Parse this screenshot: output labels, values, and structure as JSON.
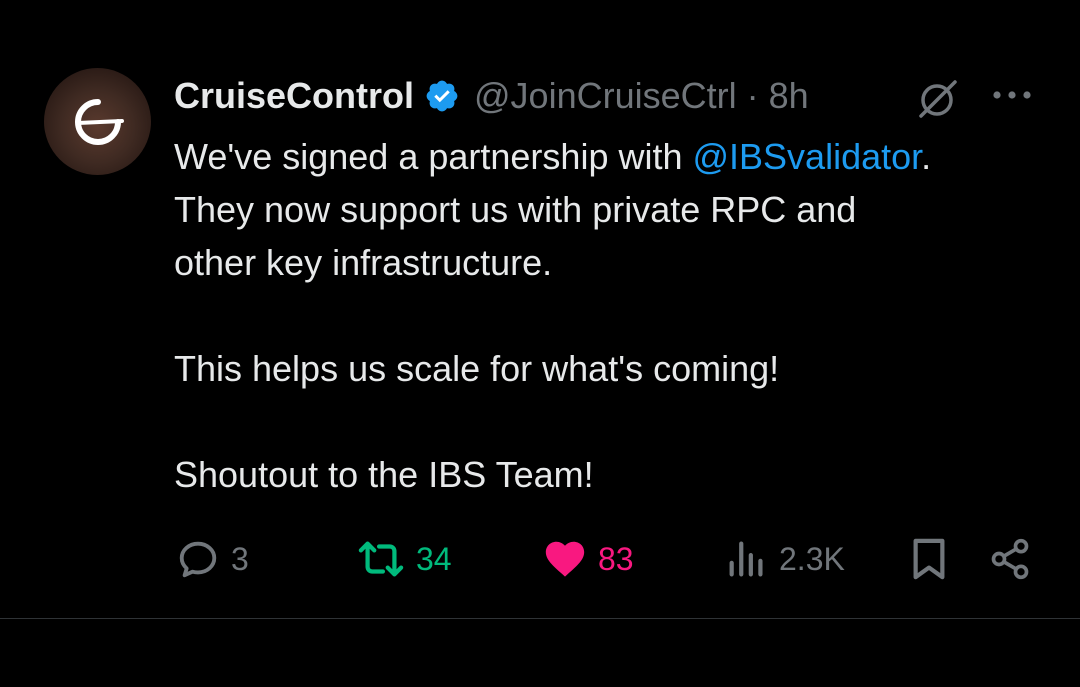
{
  "author": {
    "display_name": "CruiseControl",
    "handle": "@JoinCruiseCtrl",
    "separator": "·",
    "time": "8h"
  },
  "tweet": {
    "line1_prefix": "We've signed a partnership with ",
    "mention": "@IBSvalidator",
    "line1_suffix": ".",
    "line2": "They now support us with private RPC and",
    "line3": "other key infrastructure.",
    "line4": "This helps us scale for what's coming!",
    "line5": "Shoutout to the IBS Team!"
  },
  "metrics": {
    "replies": "3",
    "reposts": "34",
    "likes": "83",
    "views": "2.3K"
  },
  "colors": {
    "background": "#000000",
    "text": "#e7e9ea",
    "muted": "#71767b",
    "link": "#1d9bf0",
    "repost_active": "#00ba7c",
    "like_active": "#f91880",
    "verified": "#1d9bf0"
  },
  "icons": {
    "avatar": "cruisecontrol-logo",
    "verified": "verified-badge-icon",
    "grok": "grok-icon",
    "more": "more-icon",
    "reply": "reply-icon",
    "repost": "repost-icon",
    "like": "heart-icon",
    "views": "views-icon",
    "bookmark": "bookmark-icon",
    "share": "share-icon"
  }
}
